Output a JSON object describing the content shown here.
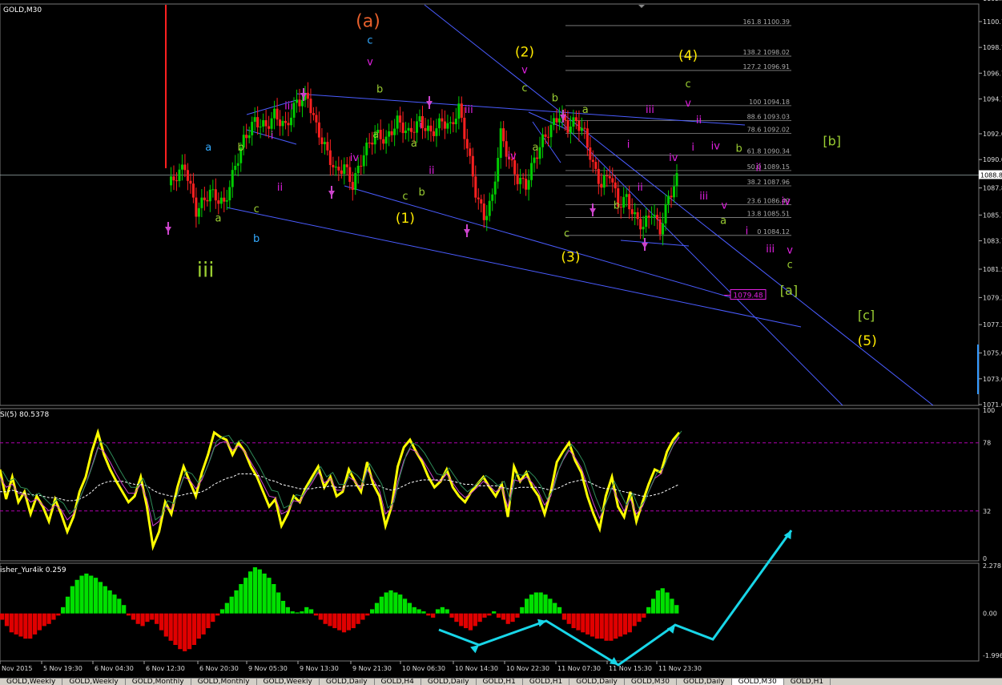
{
  "chart_data": [
    {
      "type": "candlestick",
      "title": "GOLD,M30",
      "ylim": [
        1071.0,
        1102.0
      ],
      "y_ticks": [
        "1102.5",
        "1100.7",
        "1098.7",
        "1096.7",
        "1094.7",
        "1092.0",
        "1090.0",
        "1087.8",
        "1085.7",
        "1083.7",
        "1081.5",
        "1079.3",
        "1077.2",
        "1075.0",
        "1073.0",
        "1071.0"
      ],
      "current_price": "1088.8",
      "target_label": "1079.48",
      "fib_levels": [
        {
          "label": "161.8 1100.39",
          "price": 1100.39
        },
        {
          "label": "138.2 1098.02",
          "price": 1098.02
        },
        {
          "label": "127.2 1096.91",
          "price": 1096.91
        },
        {
          "label": "100 1094.18",
          "price": 1094.18
        },
        {
          "label": "88.6 1093.03",
          "price": 1093.03
        },
        {
          "label": "78.6 1092.02",
          "price": 1092.02
        },
        {
          "label": "61.8 1090.34",
          "price": 1090.34
        },
        {
          "label": "50.0 1089.15",
          "price": 1089.15
        },
        {
          "label": "38.2 1087.96",
          "price": 1087.96
        },
        {
          "label": "23.6 1086.49",
          "price": 1086.49
        },
        {
          "label": "13.8 1085.51",
          "price": 1085.51
        },
        {
          "label": "0 1084.12",
          "price": 1084.12
        }
      ],
      "close_path": [
        [
          0,
          1088.0
        ],
        [
          6,
          1089.5
        ],
        [
          10,
          1086.0
        ],
        [
          15,
          1087.5
        ],
        [
          20,
          1086.5
        ],
        [
          24,
          1089.5
        ],
        [
          27,
          1091.5
        ],
        [
          31,
          1093.0
        ],
        [
          35,
          1092.5
        ],
        [
          38,
          1093.5
        ],
        [
          42,
          1092.5
        ],
        [
          46,
          1094.5
        ],
        [
          50,
          1094.8
        ],
        [
          53,
          1092.5
        ],
        [
          57,
          1090.5
        ],
        [
          60,
          1089.0
        ],
        [
          63,
          1089.5
        ],
        [
          66,
          1088.0
        ],
        [
          70,
          1090.5
        ],
        [
          74,
          1092.0
        ],
        [
          78,
          1091.5
        ],
        [
          82,
          1093.0
        ],
        [
          86,
          1092.0
        ],
        [
          90,
          1093.0
        ],
        [
          94,
          1092.0
        ],
        [
          98,
          1093.0
        ],
        [
          101,
          1092.5
        ],
        [
          104,
          1094.0
        ],
        [
          107,
          1091.0
        ],
        [
          110,
          1087.5
        ],
        [
          113,
          1085.5
        ],
        [
          116,
          1087.0
        ],
        [
          119,
          1092.0
        ],
        [
          122,
          1090.0
        ],
        [
          125,
          1088.5
        ],
        [
          128,
          1088.0
        ],
        [
          131,
          1090.0
        ],
        [
          134,
          1091.5
        ],
        [
          137,
          1092.5
        ],
        [
          140,
          1093.5
        ],
        [
          143,
          1092.5
        ],
        [
          146,
          1093.0
        ],
        [
          149,
          1092.0
        ],
        [
          152,
          1089.5
        ],
        [
          155,
          1088.0
        ],
        [
          158,
          1089.0
        ],
        [
          161,
          1086.5
        ],
        [
          164,
          1087.0
        ],
        [
          167,
          1085.5
        ],
        [
          170,
          1084.8
        ],
        [
          173,
          1086.0
        ],
        [
          176,
          1084.5
        ],
        [
          179,
          1087.0
        ],
        [
          182,
          1088.5
        ]
      ],
      "wave_labels": [
        {
          "text": "(a)",
          "x": 0.376,
          "p": 1100.3,
          "color": "#e8602c"
        },
        {
          "text": "c",
          "x": 0.378,
          "p": 1099.0,
          "color": "#33aaff"
        },
        {
          "text": "v",
          "x": 0.378,
          "p": 1097.3,
          "color": "#e020e0"
        },
        {
          "text": "b",
          "x": 0.388,
          "p": 1095.2,
          "color": "#9acd32"
        },
        {
          "text": "(2)",
          "x": 0.536,
          "p": 1098.0,
          "color": "#ffea00"
        },
        {
          "text": "v",
          "x": 0.536,
          "p": 1096.7,
          "color": "#e020e0"
        },
        {
          "text": "c",
          "x": 0.536,
          "p": 1095.3,
          "color": "#9acd32"
        },
        {
          "text": "b",
          "x": 0.567,
          "p": 1094.5,
          "color": "#9acd32"
        },
        {
          "text": "(4)",
          "x": 0.703,
          "p": 1097.7,
          "color": "#ffea00"
        },
        {
          "text": "c",
          "x": 0.703,
          "p": 1095.6,
          "color": "#9acd32"
        },
        {
          "text": "v",
          "x": 0.703,
          "p": 1094.1,
          "color": "#e020e0"
        },
        {
          "text": "ii",
          "x": 0.714,
          "p": 1092.8,
          "color": "#e020e0"
        },
        {
          "text": "iii",
          "x": 0.295,
          "p": 1093.9,
          "color": "#e020e0"
        },
        {
          "text": "i",
          "x": 0.278,
          "p": 1091.6,
          "color": "#e020e0"
        },
        {
          "text": "a",
          "x": 0.213,
          "p": 1090.7,
          "color": "#33aaff"
        },
        {
          "text": "b",
          "x": 0.246,
          "p": 1090.7,
          "color": "#9acd32"
        },
        {
          "text": "ii",
          "x": 0.286,
          "p": 1087.6,
          "color": "#e020e0"
        },
        {
          "text": "c",
          "x": 0.262,
          "p": 1085.9,
          "color": "#9acd32"
        },
        {
          "text": "a",
          "x": 0.223,
          "p": 1085.2,
          "color": "#9acd32"
        },
        {
          "text": "b",
          "x": 0.262,
          "p": 1083.6,
          "color": "#33aaff"
        },
        {
          "text": "iii",
          "x": 0.21,
          "p": 1080.9,
          "color": "#9acd32"
        },
        {
          "text": "iv",
          "x": 0.362,
          "p": 1089.9,
          "color": "#e020e0"
        },
        {
          "text": "a",
          "x": 0.384,
          "p": 1091.7,
          "color": "#9acd32"
        },
        {
          "text": "a",
          "x": 0.423,
          "p": 1091.0,
          "color": "#9acd32"
        },
        {
          "text": "i",
          "x": 0.43,
          "p": 1092.4,
          "color": "#e020e0"
        },
        {
          "text": "ii",
          "x": 0.441,
          "p": 1088.9,
          "color": "#e020e0"
        },
        {
          "text": "b",
          "x": 0.431,
          "p": 1087.2,
          "color": "#9acd32"
        },
        {
          "text": "c",
          "x": 0.414,
          "p": 1086.9,
          "color": "#9acd32"
        },
        {
          "text": "(1)",
          "x": 0.414,
          "p": 1085.1,
          "color": "#ffea00"
        },
        {
          "text": "iii",
          "x": 0.479,
          "p": 1093.6,
          "color": "#e020e0"
        },
        {
          "text": "iv",
          "x": 0.523,
          "p": 1090.0,
          "color": "#e020e0"
        },
        {
          "text": "a",
          "x": 0.547,
          "p": 1090.7,
          "color": "#9acd32"
        },
        {
          "text": "a",
          "x": 0.598,
          "p": 1093.6,
          "color": "#9acd32"
        },
        {
          "text": "i",
          "x": 0.642,
          "p": 1090.9,
          "color": "#e020e0"
        },
        {
          "text": "ii",
          "x": 0.654,
          "p": 1087.6,
          "color": "#e020e0"
        },
        {
          "text": "b",
          "x": 0.63,
          "p": 1086.2,
          "color": "#9acd32"
        },
        {
          "text": "c",
          "x": 0.579,
          "p": 1084.0,
          "color": "#9acd32"
        },
        {
          "text": "(3)",
          "x": 0.583,
          "p": 1082.1,
          "color": "#ffea00"
        },
        {
          "text": "iii",
          "x": 0.664,
          "p": 1093.6,
          "color": "#e020e0"
        },
        {
          "text": "iv",
          "x": 0.688,
          "p": 1089.9,
          "color": "#e020e0"
        },
        {
          "text": "i",
          "x": 0.708,
          "p": 1090.7,
          "color": "#e020e0"
        },
        {
          "text": "iv",
          "x": 0.731,
          "p": 1090.8,
          "color": "#e020e0"
        },
        {
          "text": "b",
          "x": 0.755,
          "p": 1090.6,
          "color": "#9acd32"
        },
        {
          "text": "ii",
          "x": 0.775,
          "p": 1089.1,
          "color": "#e020e0"
        },
        {
          "text": "iii",
          "x": 0.719,
          "p": 1086.9,
          "color": "#e020e0"
        },
        {
          "text": "v",
          "x": 0.74,
          "p": 1086.2,
          "color": "#e020e0"
        },
        {
          "text": "a",
          "x": 0.739,
          "p": 1085.0,
          "color": "#9acd32"
        },
        {
          "text": "i",
          "x": 0.763,
          "p": 1084.2,
          "color": "#e020e0"
        },
        {
          "text": "iv",
          "x": 0.803,
          "p": 1086.5,
          "color": "#e020e0"
        },
        {
          "text": "[b]",
          "x": 0.85,
          "p": 1091.1,
          "color": "#9acd32"
        },
        {
          "text": "iii",
          "x": 0.787,
          "p": 1082.8,
          "color": "#e020e0"
        },
        {
          "text": "v",
          "x": 0.807,
          "p": 1082.7,
          "color": "#e020e0"
        },
        {
          "text": "c",
          "x": 0.807,
          "p": 1081.6,
          "color": "#9acd32"
        },
        {
          "text": "[a]",
          "x": 0.806,
          "p": 1079.5,
          "color": "#9acd32"
        },
        {
          "text": "[c]",
          "x": 0.885,
          "p": 1077.6,
          "color": "#9acd32"
        },
        {
          "text": "(5)",
          "x": 0.886,
          "p": 1075.6,
          "color": "#ffea00"
        }
      ]
    },
    {
      "type": "line",
      "title": "SI(5) 80.5378",
      "ylim": [
        0,
        100
      ],
      "y_ticks": [
        "100",
        "78",
        "32",
        "0"
      ],
      "levels": [
        78,
        32
      ],
      "series": [
        {
          "values": [
            60,
            40,
            55,
            38,
            45,
            30,
            42,
            35,
            25,
            40,
            30,
            18,
            28,
            45,
            55,
            72,
            85,
            70,
            60,
            52,
            45,
            38,
            42,
            55,
            35,
            8,
            18,
            38,
            30,
            48,
            62,
            52,
            42,
            58,
            70,
            85,
            82,
            80,
            70,
            78,
            72,
            62,
            55,
            45,
            35,
            40,
            22,
            30,
            42,
            38,
            48,
            55,
            62,
            48,
            55,
            42,
            45,
            60,
            52,
            45,
            65,
            50,
            42,
            22,
            35,
            62,
            75,
            80,
            72,
            65,
            55,
            48,
            52,
            60,
            48,
            42,
            38,
            45,
            50,
            55,
            48,
            42,
            50,
            28,
            62,
            52,
            58,
            48,
            42,
            30,
            45,
            65,
            72,
            78,
            66,
            58,
            42,
            30,
            20,
            42,
            55,
            35,
            28,
            45,
            25,
            38,
            50,
            60,
            58,
            72,
            80,
            85
          ]
        },
        {
          "values": [
            55,
            48,
            50,
            44,
            43,
            38,
            40,
            36,
            32,
            36,
            33,
            26,
            30,
            40,
            50,
            62,
            75,
            72,
            65,
            57,
            50,
            44,
            44,
            50,
            40,
            22,
            25,
            35,
            33,
            43,
            55,
            53,
            47,
            53,
            63,
            75,
            78,
            79,
            73,
            76,
            72,
            65,
            58,
            50,
            42,
            41,
            30,
            32,
            39,
            38,
            45,
            51,
            58,
            51,
            54,
            46,
            46,
            55,
            52,
            47,
            60,
            53,
            46,
            30,
            34,
            52,
            66,
            74,
            72,
            67,
            60,
            53,
            52,
            57,
            51,
            45,
            41,
            44,
            48,
            52,
            49,
            45,
            48,
            35,
            53,
            52,
            55,
            51,
            45,
            36,
            42,
            57,
            66,
            73,
            68,
            61,
            49,
            37,
            27,
            37,
            48,
            40,
            32,
            40,
            30,
            35,
            45,
            54,
            57,
            67,
            76,
            82
          ]
        },
        {
          "values": [
            45,
            45,
            46,
            45,
            44,
            43,
            43,
            42,
            41,
            41,
            40,
            39,
            39,
            40,
            42,
            45,
            49,
            51,
            52,
            52,
            52,
            51,
            50,
            50,
            49,
            46,
            44,
            43,
            42,
            42,
            43,
            44,
            44,
            45,
            47,
            50,
            52,
            54,
            55,
            57,
            57,
            57,
            56,
            55,
            53,
            52,
            50,
            49,
            48,
            47,
            47,
            47,
            48,
            48,
            49,
            48,
            48,
            49,
            49,
            49,
            50,
            50,
            49,
            47,
            46,
            47,
            49,
            51,
            52,
            53,
            53,
            53,
            53,
            53,
            52,
            51,
            50,
            50,
            49,
            49,
            49,
            49,
            48,
            47,
            47,
            48,
            48,
            48,
            48,
            47,
            46,
            47,
            49,
            51,
            52,
            53,
            52,
            50,
            48,
            47,
            47,
            46,
            45,
            44,
            43,
            42,
            42,
            43,
            44,
            46,
            48,
            50
          ]
        }
      ]
    },
    {
      "type": "bar",
      "title": "isher_Yur4ik 0.259",
      "ylim": [
        -1.996,
        2.278
      ],
      "y_ticks": [
        "2.278",
        "0.00",
        "-1.996"
      ],
      "values": [
        -0.3,
        -0.6,
        -0.9,
        -1.0,
        -1.1,
        -1.2,
        -1.2,
        -1.0,
        -0.8,
        -0.6,
        -0.5,
        -0.3,
        -0.1,
        0.3,
        0.8,
        1.3,
        1.6,
        1.8,
        1.9,
        1.8,
        1.7,
        1.5,
        1.3,
        1.1,
        0.9,
        0.7,
        0.4,
        -0.1,
        -0.3,
        -0.5,
        -0.6,
        -0.4,
        -0.3,
        -0.5,
        -0.8,
        -1.1,
        -1.3,
        -1.5,
        -1.7,
        -1.8,
        -1.7,
        -1.5,
        -1.2,
        -1.0,
        -0.7,
        -0.4,
        -0.1,
        0.2,
        0.5,
        0.8,
        1.1,
        1.4,
        1.7,
        2.0,
        2.2,
        2.1,
        1.9,
        1.7,
        1.4,
        1.0,
        0.6,
        0.3,
        0.1,
        0.05,
        0.1,
        0.3,
        0.2,
        -0.1,
        -0.3,
        -0.5,
        -0.6,
        -0.7,
        -0.8,
        -0.9,
        -0.8,
        -0.7,
        -0.5,
        -0.3,
        -0.1,
        0.2,
        0.5,
        0.8,
        1.0,
        1.1,
        1.0,
        0.9,
        0.7,
        0.5,
        0.3,
        0.2,
        0.1,
        -0.1,
        -0.2,
        0.2,
        0.3,
        0.2,
        -0.2,
        -0.4,
        -0.6,
        -0.7,
        -0.8,
        -0.6,
        -0.4,
        -0.2,
        -0.1,
        0.1,
        -0.2,
        -0.3,
        -0.5,
        -0.4,
        -0.2,
        0.3,
        0.7,
        0.9,
        1.0,
        1.0,
        0.9,
        0.7,
        0.5,
        0.3,
        -0.3,
        -0.5,
        -0.7,
        -0.8,
        -0.9,
        -1.0,
        -1.1,
        -1.2,
        -1.2,
        -1.3,
        -1.3,
        -1.2,
        -1.1,
        -1.0,
        -0.9,
        -0.6,
        -0.4,
        -0.2,
        0.3,
        0.7,
        1.1,
        1.2,
        1.0,
        0.7,
        0.4
      ]
    }
  ],
  "time_axis": [
    "Nov 2015",
    "5 Nov 19:30",
    "6 Nov 04:30",
    "6 Nov 12:30",
    "6 Nov 20:30",
    "9 Nov 05:30",
    "9 Nov 13:30",
    "9 Nov 21:30",
    "10 Nov 06:30",
    "10 Nov 14:30",
    "10 Nov 22:30",
    "11 Nov 07:30",
    "11 Nov 15:30",
    "11 Nov 23:30"
  ],
  "tabs": [
    "GOLD,Weekly",
    "GOLD,Weekly",
    "GOLD,Monthly",
    "GOLD,Monthly",
    "GOLD,Weekly",
    "GOLD,Daily",
    "GOLD,H4",
    "GOLD,Daily",
    "GOLD,H1",
    "GOLD,H1",
    "GOLD,Daily",
    "GOLD,M30",
    "GOLD,Daily",
    "GOLD,M30",
    "GOLD,H1"
  ],
  "active_tab": 13,
  "colors": {
    "bull": "#00cc00",
    "bear": "#ff2020",
    "rsi": "#ffff00",
    "fib": "#8a8a8a",
    "trend": "#4a5cff",
    "cyan": "#18d6e8",
    "hist_up": "#00e000",
    "hist_down": "#e00000"
  }
}
